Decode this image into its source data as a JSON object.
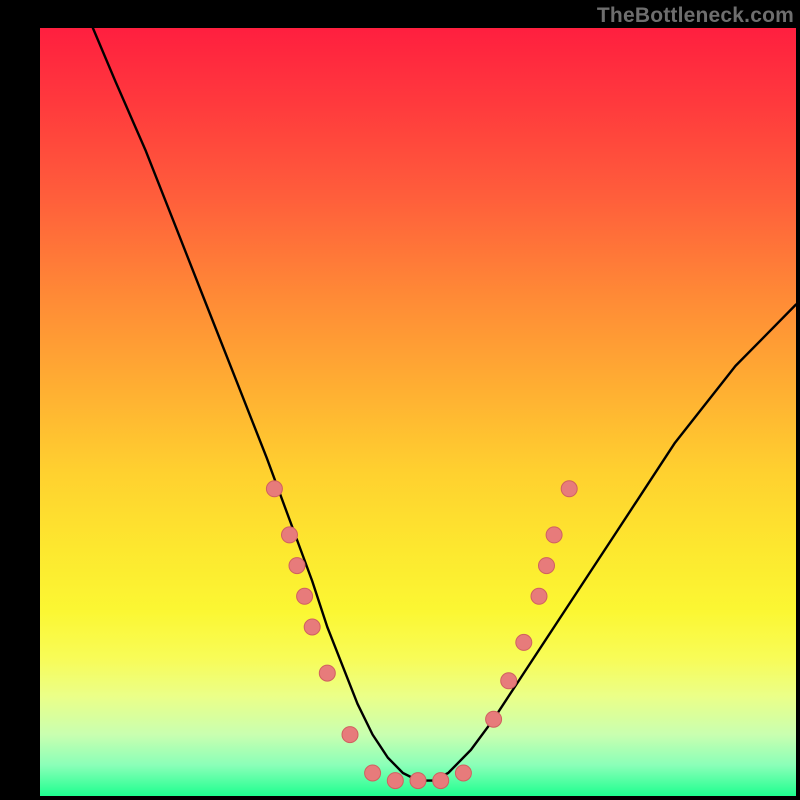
{
  "watermark": "TheBottleneck.com",
  "chart_data": {
    "type": "line",
    "title": "",
    "xlabel": "",
    "ylabel": "",
    "xlim": [
      0,
      100
    ],
    "ylim": [
      0,
      100
    ],
    "series": [
      {
        "name": "curve",
        "x": [
          7,
          10,
          14,
          18,
          22,
          26,
          30,
          33,
          36,
          38,
          40,
          42,
          44,
          46,
          48,
          50,
          52,
          54,
          57,
          60,
          64,
          68,
          72,
          76,
          80,
          84,
          88,
          92,
          96,
          100
        ],
        "y": [
          100,
          93,
          84,
          74,
          64,
          54,
          44,
          36,
          28,
          22,
          17,
          12,
          8,
          5,
          3,
          2,
          2,
          3,
          6,
          10,
          16,
          22,
          28,
          34,
          40,
          46,
          51,
          56,
          60,
          64
        ]
      }
    ],
    "markers": [
      {
        "x": 31,
        "y": 40
      },
      {
        "x": 33,
        "y": 34
      },
      {
        "x": 34,
        "y": 30
      },
      {
        "x": 35,
        "y": 26
      },
      {
        "x": 36,
        "y": 22
      },
      {
        "x": 38,
        "y": 16
      },
      {
        "x": 41,
        "y": 8
      },
      {
        "x": 44,
        "y": 3
      },
      {
        "x": 47,
        "y": 2
      },
      {
        "x": 50,
        "y": 2
      },
      {
        "x": 53,
        "y": 2
      },
      {
        "x": 56,
        "y": 3
      },
      {
        "x": 60,
        "y": 10
      },
      {
        "x": 62,
        "y": 15
      },
      {
        "x": 64,
        "y": 20
      },
      {
        "x": 66,
        "y": 26
      },
      {
        "x": 67,
        "y": 30
      },
      {
        "x": 68,
        "y": 34
      },
      {
        "x": 70,
        "y": 40
      }
    ],
    "colors": {
      "curve_stroke": "#000000",
      "marker_fill": "#e77b7b",
      "marker_stroke": "#d06060"
    }
  }
}
